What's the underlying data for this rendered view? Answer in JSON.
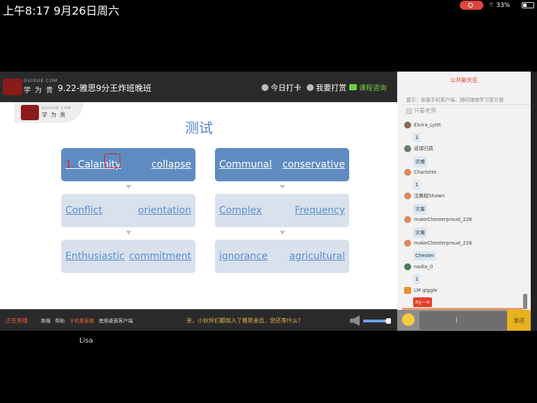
{
  "status_bar": {
    "time": "上午8:17  9月26日周六",
    "battery": "33%",
    "battery_level": 0.33
  },
  "header": {
    "logo_sub": "GUIXUE.COM",
    "logo_text": "学为贵",
    "course_title": "9.22-雅思9分王炸班晚班",
    "checkin_label": "今日打卡",
    "reward_label": "我要打赏",
    "consult_label": "课程咨询"
  },
  "slide": {
    "logo_sub": "GUIXUE.COM",
    "logo_text": "学为贵",
    "title": "测试",
    "annotation": "1.",
    "boxes": [
      {
        "left": "Calamity",
        "right": "collapse"
      },
      {
        "left": "Communal",
        "right": "conservative"
      },
      {
        "left": "Conflict",
        "right": "orientation"
      },
      {
        "left": "Complex",
        "right": "Frequency"
      },
      {
        "left": "Enthusiastic",
        "right": "commitment"
      },
      {
        "left": "ignorance",
        "right": "agricultural"
      }
    ]
  },
  "bottom_bar": {
    "live_label": "正在直播",
    "new_label": "新版",
    "help_label": "帮助",
    "mobile_label": "手机看直播",
    "desktop_label": "使用桌面客户端",
    "notice": "亲，小伙伴们都加入了雅思会员，您还等什么？",
    "volume": 0.85
  },
  "chat": {
    "title": "公共聊天区",
    "tip": "提示：安装手机客户端，随时随地学习更方便",
    "filter_label": "只看老师",
    "messages": [
      {
        "user": "Elvira_Lyttt",
        "text": "1"
      },
      {
        "user": "返璞归真",
        "text": "灾难"
      },
      {
        "user": "Charlotte",
        "text": "1"
      },
      {
        "user": "沈晨程Shawn",
        "text": "灾害"
      },
      {
        "user": "makeChesterproud_226",
        "text": "灾难"
      },
      {
        "user": "makeChesterproud_226",
        "text": "Chester"
      },
      {
        "user": "nadia_0",
        "text": "1"
      },
      {
        "user": "LM giggle",
        "text": "ity---n"
      }
    ],
    "send_label": "发送"
  },
  "caption": "Lisa"
}
